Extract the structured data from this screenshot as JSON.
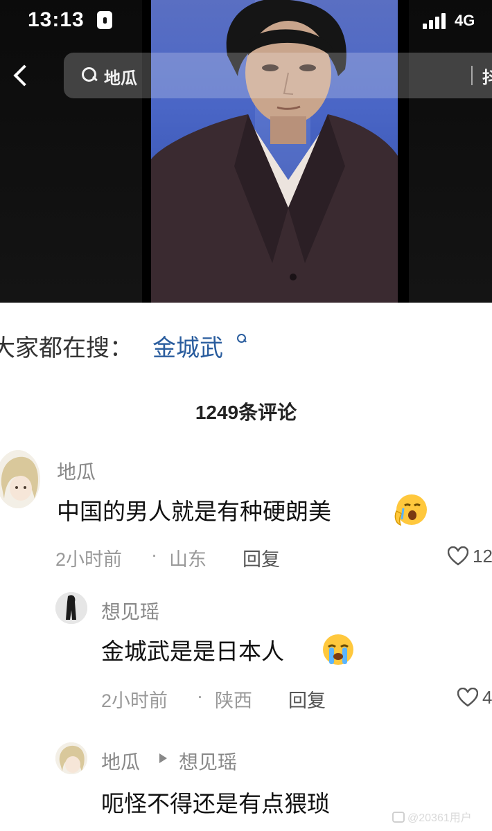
{
  "status_bar": {
    "time": "13:13",
    "network": "4G"
  },
  "search": {
    "query": "地瓜",
    "action_partial": "抖"
  },
  "everyone_searching": {
    "label": "大家都在搜：",
    "term": "金城武"
  },
  "comments_header": "1249条评论",
  "comments": [
    {
      "user": "地瓜",
      "text": "中国的男人就是有种硬朗美",
      "emoji": "crying-face",
      "time": "2小时前",
      "location": "山东",
      "reply_label": "回复",
      "likes": "12"
    }
  ],
  "replies": [
    {
      "user": "想见瑶",
      "text": "金城武是是日本人",
      "emoji": "loudly-crying-face",
      "time": "2小时前",
      "location": "陕西",
      "reply_label": "回复",
      "likes": "4"
    },
    {
      "user": "地瓜",
      "reply_to": "想见瑶",
      "text": "呃怪不得还是有点猥琐"
    }
  ],
  "watermark": "@20361用户",
  "colors": {
    "link_blue": "#2a5d9e",
    "meta_grey": "#999999",
    "name_grey": "#888888"
  }
}
